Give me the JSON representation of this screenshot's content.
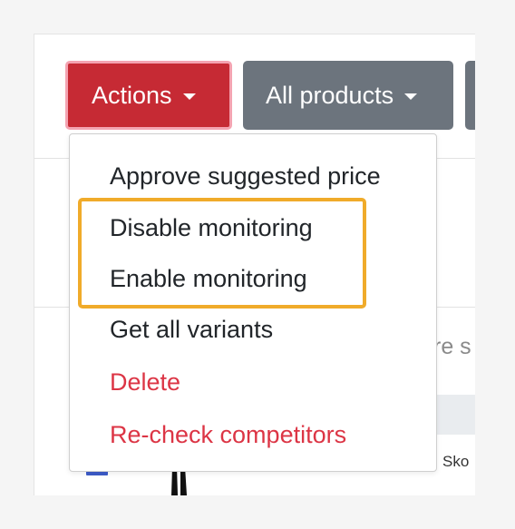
{
  "toolbar": {
    "actions_label": "Actions",
    "all_products_label": "All products"
  },
  "background": {
    "partial_text": "re s",
    "cell_text": "Sko"
  },
  "menu": {
    "items": [
      {
        "label": "Approve suggested price",
        "style": "normal"
      },
      {
        "label": "Disable monitoring",
        "style": "normal"
      },
      {
        "label": "Enable monitoring",
        "style": "normal"
      },
      {
        "label": "Get all variants",
        "style": "normal"
      },
      {
        "label": "Delete",
        "style": "danger"
      },
      {
        "label": "Re-check competitors",
        "style": "danger"
      }
    ]
  },
  "colors": {
    "actions_button": "#c62a34",
    "secondary_button": "#6c747d",
    "danger_text": "#dc3545",
    "highlight": "#f0ab2a"
  },
  "icons": [
    "caret-down-icon"
  ]
}
